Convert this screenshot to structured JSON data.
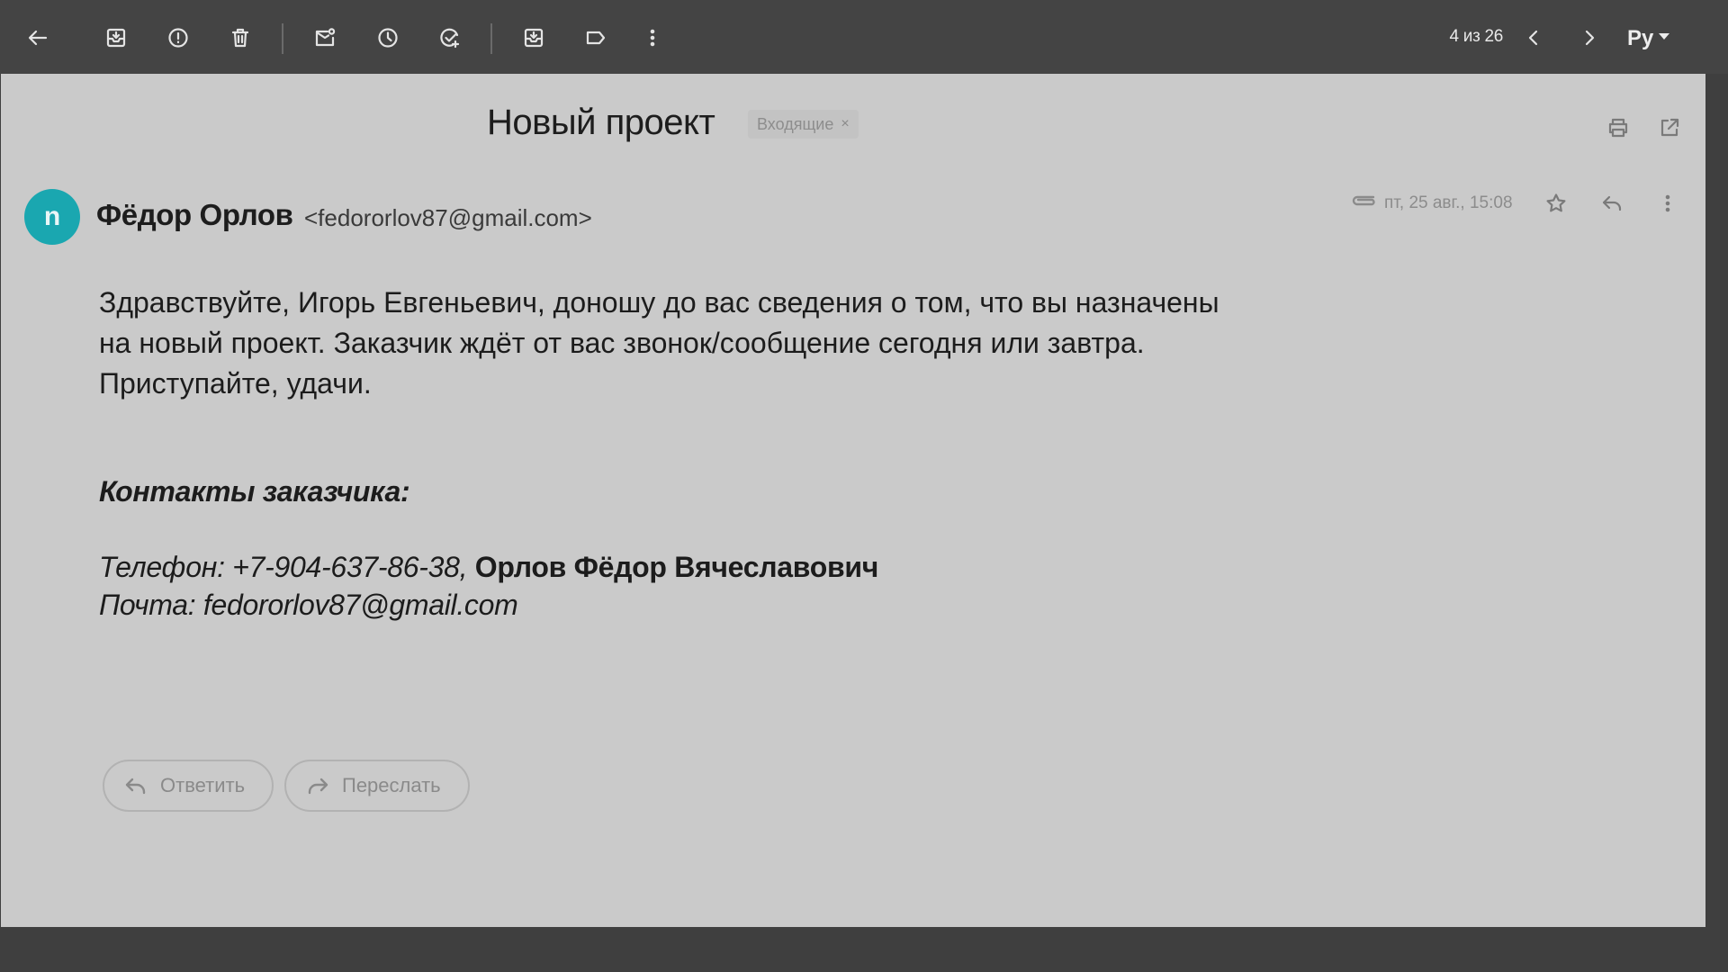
{
  "toolbar": {
    "icons": [
      "back-arrow-icon",
      "archive-icon",
      "spam-icon",
      "delete-icon",
      "mark-unread-icon",
      "snooze-icon",
      "add-task-icon",
      "move-to-icon",
      "label-icon",
      "more-vert-icon"
    ],
    "pager": "4 из 26",
    "language": "Ру"
  },
  "message": {
    "subject": "Новый проект",
    "folder_chip": "Входящие",
    "folder_chip_close": "×",
    "sender": {
      "initial": "n",
      "name": "Фёдор Орлов",
      "email": "<fedororlov87@gmail.com>",
      "avatar_color": "#1aa7b0"
    },
    "date": "пт, 25 авг., 15:08",
    "body_lines": [
      "Здравствуйте, Игорь Евгеньевич, доношу до вас сведения о том, что вы назначены",
      "на новый проект. Заказчик ждёт от вас звонок/сообщение сегодня или завтра.",
      "Приступайте, удачи."
    ],
    "contacts_title": "Контакты заказчика:",
    "phone_line": "Телефон: +7-904-637-86-38,",
    "phone_name": "Орлов Фёдор Вячеславович",
    "mail_line": "Почта: fedororlov87@gmail.com"
  },
  "actions": {
    "reply_label": "Ответить",
    "forward_label": "Переслать"
  },
  "colors": {
    "toolbar_bg": "#444444",
    "pane_bg": "#cacaca",
    "frame_bg": "#3f3f3f"
  }
}
